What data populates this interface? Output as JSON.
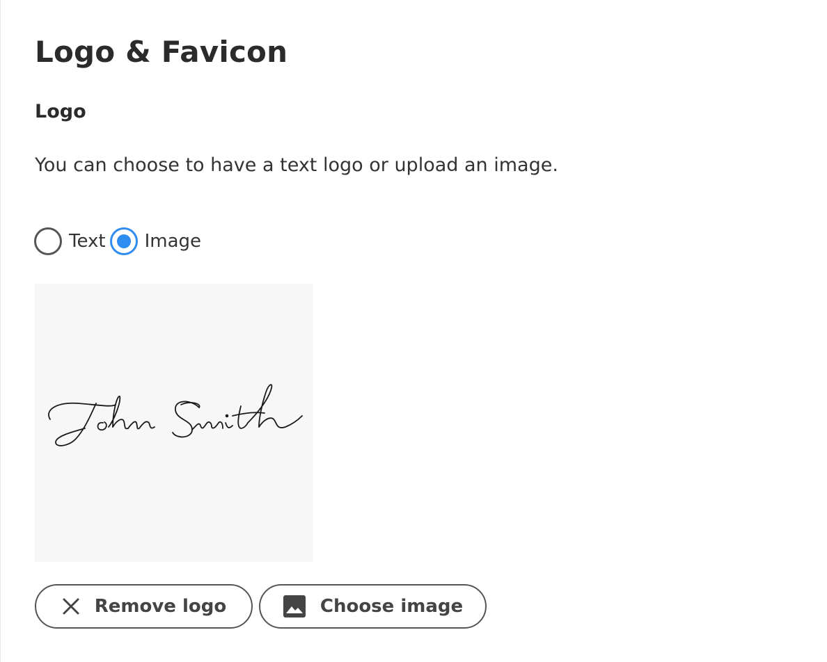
{
  "page": {
    "title": "Logo & Favicon"
  },
  "logo_section": {
    "heading": "Logo",
    "description": "You can choose to have a text logo or upload an image.",
    "options": [
      {
        "label": "Text",
        "selected": false
      },
      {
        "label": "Image",
        "selected": true
      }
    ],
    "preview": {
      "signature_text": "John Smith",
      "background_color": "#f7f7f7"
    }
  },
  "actions": {
    "remove_label": "Remove logo",
    "remove_icon": "close-icon",
    "choose_label": "Choose image",
    "choose_icon": "image-icon"
  },
  "colors": {
    "accent": "#2f8cf0",
    "text": "#333333",
    "border": "#555555"
  }
}
